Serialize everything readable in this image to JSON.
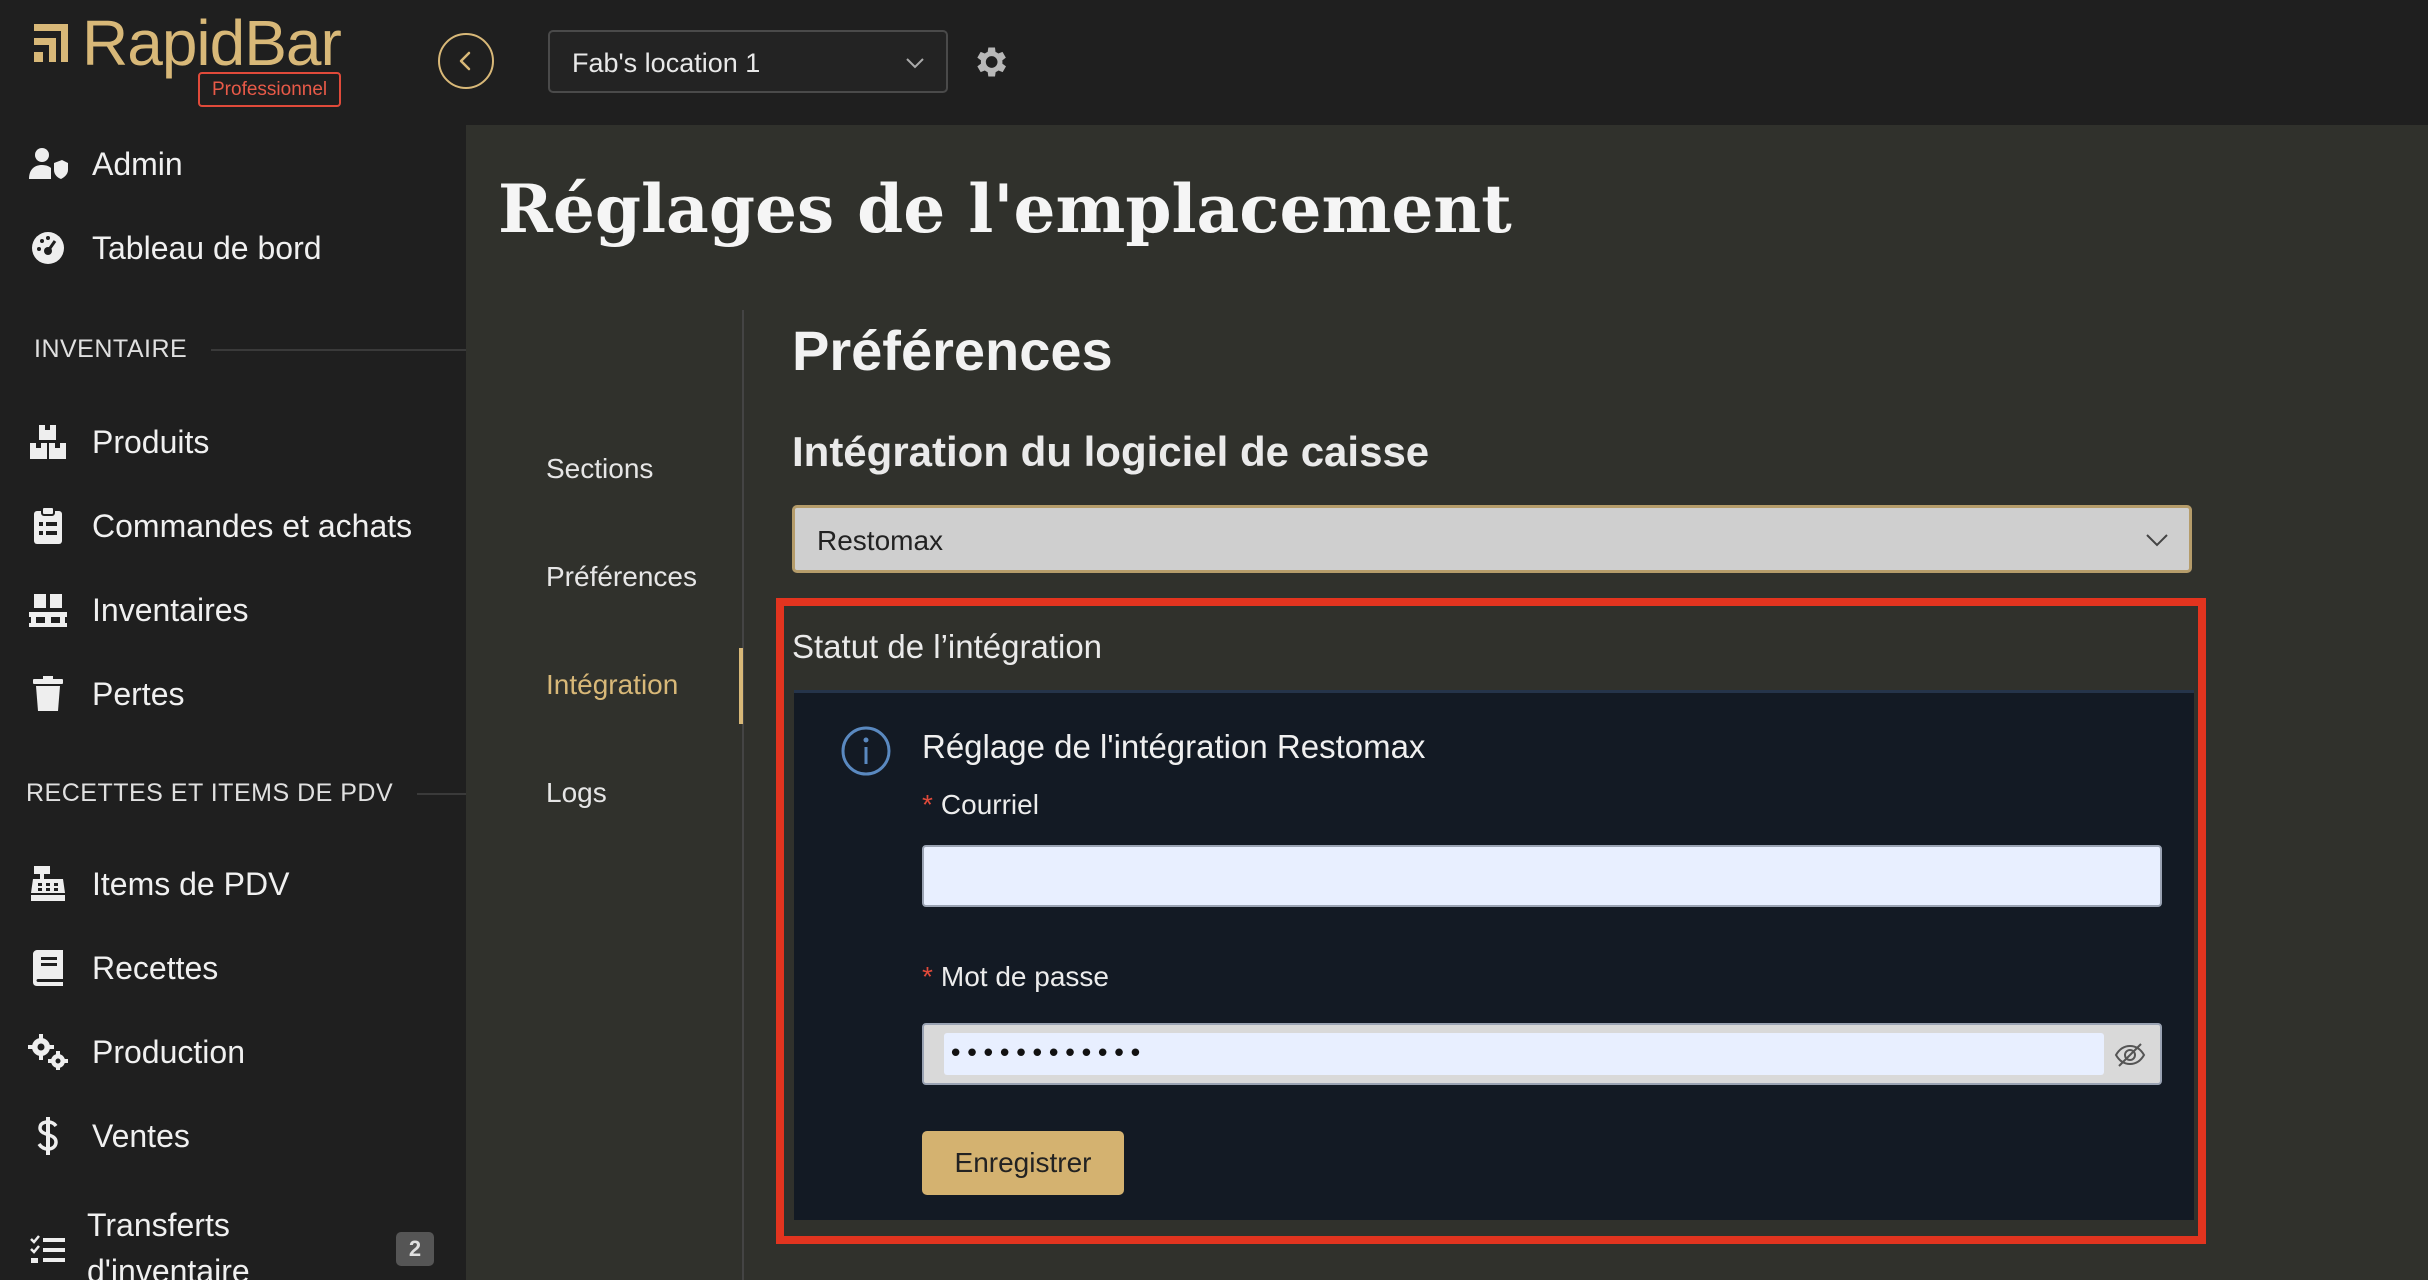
{
  "brand": {
    "name": "RapidBar",
    "badge": "Professionnel"
  },
  "topbar": {
    "location_value": "Fab's location 1"
  },
  "sidebar": {
    "items_top": [
      {
        "label": "Admin",
        "icon": "user-shield-icon"
      },
      {
        "label": "Tableau de bord",
        "icon": "dashboard-icon"
      }
    ],
    "section_inventory": "INVENTAIRE",
    "items_inventory": [
      {
        "label": "Produits",
        "icon": "boxes-icon"
      },
      {
        "label": "Commandes et achats",
        "icon": "clipboard-icon"
      },
      {
        "label": "Inventaires",
        "icon": "pallet-icon"
      },
      {
        "label": "Pertes",
        "icon": "trash-icon"
      }
    ],
    "section_recipes": "RECETTES ET ITEMS DE PDV",
    "items_recipes": [
      {
        "label": "Items de PDV",
        "icon": "cash-register-icon"
      },
      {
        "label": "Recettes",
        "icon": "book-icon"
      },
      {
        "label": "Production",
        "icon": "gears-icon"
      },
      {
        "label": "Ventes",
        "icon": "dollar-icon"
      },
      {
        "label": "Transferts d'inventaire",
        "icon": "list-check-icon",
        "badge": "2"
      }
    ]
  },
  "main": {
    "title": "Réglages de l'emplacement",
    "subnav": [
      "Sections",
      "Préférences",
      "Intégration",
      "Logs"
    ],
    "active_subnav": "Intégration",
    "section_title": "Préférences",
    "subsection_title": "Intégration du logiciel de caisse",
    "pos_select_value": "Restomax",
    "status_title": "Statut de l’intégration",
    "panel": {
      "title": "Réglage de l'intégration Restomax",
      "email_label": "Courriel",
      "email_value": "",
      "password_label": "Mot de passe",
      "password_value": "••••••••••••",
      "required_mark": "*",
      "save_label": "Enregistrer"
    }
  },
  "colors": {
    "accent": "#d8b878",
    "highlight": "#e2341f",
    "panel_bg": "#131a24"
  }
}
